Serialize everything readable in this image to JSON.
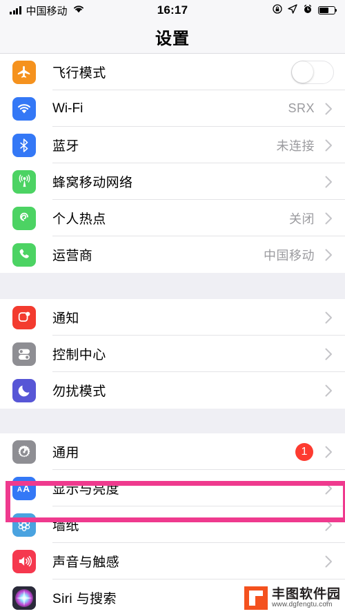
{
  "status_bar": {
    "carrier": "中国移动",
    "time": "16:17",
    "icons_left": [
      "signal-bars-icon",
      "wifi-icon"
    ],
    "icons_right": [
      "rotation-lock-icon",
      "location-arrow-icon",
      "alarm-clock-icon",
      "battery-icon"
    ],
    "battery_level_percent": 62
  },
  "navbar": {
    "title": "设置"
  },
  "groups": [
    {
      "rows": [
        {
          "icon": "airplane-icon",
          "icon_color": "#f5921e",
          "label": "飞行模式",
          "accessory": "toggle",
          "toggle_on": false
        },
        {
          "icon": "wifi-icon",
          "icon_color": "#3478f6",
          "label": "Wi-Fi",
          "detail": "SRX",
          "accessory": "chevron"
        },
        {
          "icon": "bluetooth-icon",
          "icon_color": "#3478f6",
          "label": "蓝牙",
          "detail": "未连接",
          "accessory": "chevron"
        },
        {
          "icon": "cellular-icon",
          "icon_color": "#4cd363",
          "label": "蜂窝移动网络",
          "detail": "",
          "accessory": "chevron"
        },
        {
          "icon": "hotspot-icon",
          "icon_color": "#4cd363",
          "label": "个人热点",
          "detail": "关闭",
          "accessory": "chevron"
        },
        {
          "icon": "phone-icon",
          "icon_color": "#4cd363",
          "label": "运营商",
          "detail": "中国移动",
          "accessory": "chevron"
        }
      ]
    },
    {
      "rows": [
        {
          "icon": "notifications-icon",
          "icon_color": "#f33b2f",
          "label": "通知",
          "detail": "",
          "accessory": "chevron"
        },
        {
          "icon": "control-center-icon",
          "icon_color": "#8e8e93",
          "label": "控制中心",
          "detail": "",
          "accessory": "chevron"
        },
        {
          "icon": "do-not-disturb-icon",
          "icon_color": "#5756d6",
          "label": "勿扰模式",
          "detail": "",
          "accessory": "chevron"
        }
      ]
    },
    {
      "rows": [
        {
          "icon": "gear-icon",
          "icon_color": "#8e8e93",
          "label": "通用",
          "badge": "1",
          "accessory": "chevron"
        },
        {
          "icon": "display-brightness-icon",
          "icon_color": "#3478f6",
          "label": "显示与亮度",
          "detail": "",
          "accessory": "chevron",
          "highlighted": true
        },
        {
          "icon": "wallpaper-icon",
          "icon_color": "#4aa3e0",
          "label": "墙纸",
          "detail": "",
          "accessory": "chevron"
        },
        {
          "icon": "sounds-haptics-icon",
          "icon_color": "#f5384e",
          "label": "声音与触感",
          "detail": "",
          "accessory": "chevron"
        },
        {
          "icon": "siri-icon",
          "icon_color": "#2a2a3a",
          "label": "Siri 与搜索",
          "detail": "",
          "accessory": "chevron"
        }
      ]
    }
  ],
  "highlight": {
    "target_label": "显示与亮度",
    "color": "#ef3a8e"
  },
  "watermark": {
    "name": "丰图软件园",
    "url": "www.dgfengtu.com"
  }
}
